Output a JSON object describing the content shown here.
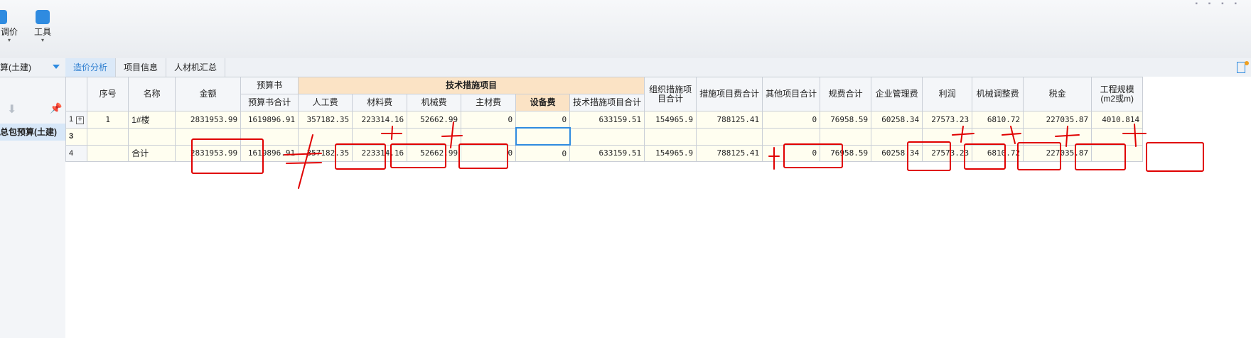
{
  "toolbar": {
    "price_adjust_label": "调价",
    "tools_label": "工具"
  },
  "left_panel": {
    "header_label": "算(土建)",
    "item_label": "总包预算(土建)"
  },
  "tabs": [
    {
      "label": "造价分析",
      "active": true
    },
    {
      "label": "项目信息",
      "active": false
    },
    {
      "label": "人材机汇总",
      "active": false
    }
  ],
  "grid": {
    "headers": {
      "seq": "序号",
      "name": "名称",
      "amount": "金额",
      "budget_group": "预算书",
      "budget_total": "预算书合计",
      "tech_group": "技术措施项目",
      "labor": "人工费",
      "material": "材料费",
      "machine": "机械费",
      "main_material": "主材费",
      "equipment": "设备费",
      "tech_total": "技术措施项目合计",
      "org_total": "组织措施项目合计",
      "measure_total": "措施项目费合计",
      "other_total": "其他项目合计",
      "fee_total": "规费合计",
      "mgmt": "企业管理费",
      "profit": "利润",
      "machine_adjust": "机械调整费",
      "tax": "税金",
      "scale": "工程规模(m2或m)"
    },
    "rows": [
      {
        "rownum": "1",
        "seq": "1",
        "name": "1#楼",
        "amount": "2831953.99",
        "budget_total": "1619896.91",
        "labor": "357182.35",
        "material": "223314.16",
        "machine": "52662.99",
        "main_material": "0",
        "equipment": "0",
        "tech_total": "633159.51",
        "org_total": "154965.9",
        "measure_total": "788125.41",
        "other_total": "0",
        "fee_total": "76958.59",
        "mgmt": "60258.34",
        "profit": "27573.23",
        "machine_adjust": "6810.72",
        "tax": "227035.87",
        "scale": "4010.814"
      },
      {
        "rownum": "3",
        "seq": "",
        "name": "",
        "amount": "",
        "budget_total": "",
        "labor": "",
        "material": "",
        "machine": "",
        "main_material": "",
        "equipment": "",
        "tech_total": "",
        "org_total": "",
        "measure_total": "",
        "other_total": "",
        "fee_total": "",
        "mgmt": "",
        "profit": "",
        "machine_adjust": "",
        "tax": "",
        "scale": ""
      },
      {
        "rownum": "4",
        "seq": "",
        "name": "合计",
        "amount": "2831953.99",
        "budget_total": "1619896.91",
        "labor": "357182.35",
        "material": "223314.16",
        "machine": "52662.99",
        "main_material": "0",
        "equipment": "0",
        "tech_total": "633159.51",
        "org_total": "154965.9",
        "measure_total": "788125.41",
        "other_total": "0",
        "fee_total": "76958.59",
        "mgmt": "60258.34",
        "profit": "27573.23",
        "machine_adjust": "6810.72",
        "tax": "227035.87",
        "scale": ""
      }
    ]
  },
  "colors": {
    "accent": "#2f8be0",
    "header_highlight": "#fbe3c5",
    "row_background": "#fffef0",
    "annotation_red": "#e00000"
  }
}
